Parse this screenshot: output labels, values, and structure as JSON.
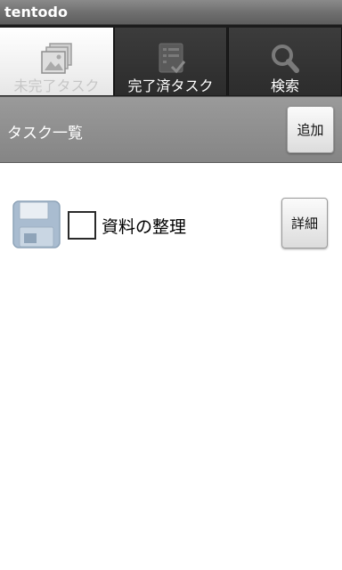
{
  "app": {
    "title": "tentodo"
  },
  "tabs": [
    {
      "label": "未完了タスク",
      "icon": "gallery-icon",
      "active": true
    },
    {
      "label": "完了済タスク",
      "icon": "checklist-icon",
      "active": false
    },
    {
      "label": "検索",
      "icon": "search-icon",
      "active": false
    }
  ],
  "header": {
    "title": "タスク一覧",
    "add_label": "追加"
  },
  "tasks": [
    {
      "icon": "floppy-disk-icon",
      "checked": false,
      "label": "資料の整理",
      "detail_label": "詳細"
    }
  ]
}
